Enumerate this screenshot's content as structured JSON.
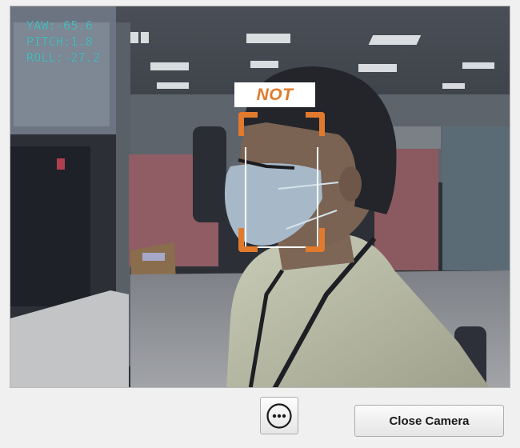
{
  "camera": {
    "pose": {
      "yaw": "YAW:-65.6",
      "pitch": "PITCH:1.8",
      "roll": "ROLL:-27.2"
    },
    "detection_label": "NOT",
    "colors": {
      "overlay_text": "#49c2c8",
      "label_text": "#e07a2a",
      "box_corner": "#e27a2e",
      "box_inner": "#ffffff"
    }
  },
  "toolbar": {
    "more_icon": "ellipsis-circle-icon",
    "close_camera_label": "Close Camera"
  }
}
